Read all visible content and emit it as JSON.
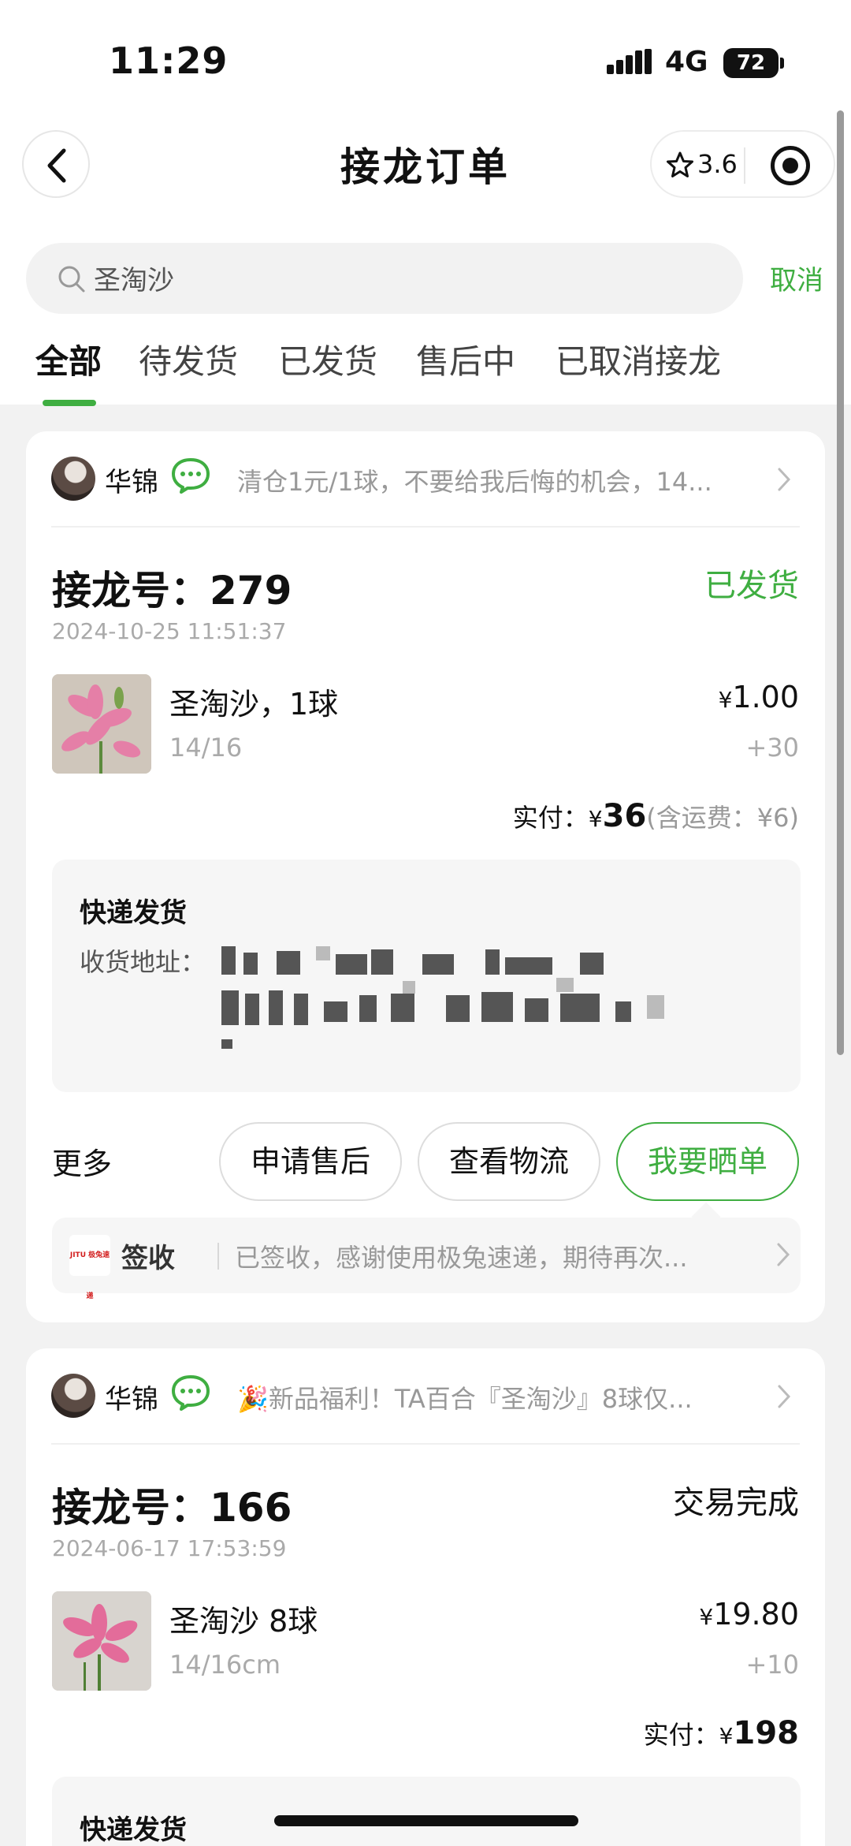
{
  "status_bar": {
    "time": "11:29",
    "network": "4G",
    "battery": "72"
  },
  "nav": {
    "title": "接龙订单",
    "rating": "3.6"
  },
  "search": {
    "query": "圣淘沙",
    "cancel_label": "取消"
  },
  "tabs": [
    "全部",
    "待发货",
    "已发货",
    "售后中",
    "已取消接龙"
  ],
  "orders": [
    {
      "shop_name": "华锦",
      "shop_desc": "清仓1元/1球，不要给我后悔的机会，14...",
      "order_no_label": "接龙号：",
      "order_no": "279",
      "status": "已发货",
      "time": "2024-10-25 11:51:37",
      "item_name": "圣淘沙，1球",
      "item_spec": "14/16",
      "price_symbol": "¥",
      "price": "1.00",
      "qty": "+30",
      "paid_label": "实付：",
      "paid_symbol": "¥",
      "paid_amount": "36",
      "shipping_note": "(含运费：¥6)",
      "delivery_title": "快递发货",
      "address_label": "收货地址：",
      "more_label": "更多",
      "buttons": [
        "申请售后",
        "查看物流",
        "我要晒单"
      ],
      "logistics_logo": "JITU 极兔速递",
      "logistics_label": "签收",
      "logistics_text": "已签收，感谢使用极兔速递，期待再次..."
    },
    {
      "shop_name": "华锦",
      "shop_desc": "🎉新品福利！TA百合『圣淘沙』8球仅...",
      "order_no_label": "接龙号：",
      "order_no": "166",
      "status": "交易完成",
      "time": "2024-06-17 17:53:59",
      "item_name": "圣淘沙 8球",
      "item_spec": "14/16cm",
      "price_symbol": "¥",
      "price": "19.80",
      "qty": "+10",
      "paid_label": "实付：",
      "paid_symbol": "¥",
      "paid_amount": "198",
      "delivery_title": "快递发货"
    }
  ],
  "colors": {
    "accent": "#3fae41",
    "muted": "#999999",
    "background": "#f2f2f2"
  }
}
